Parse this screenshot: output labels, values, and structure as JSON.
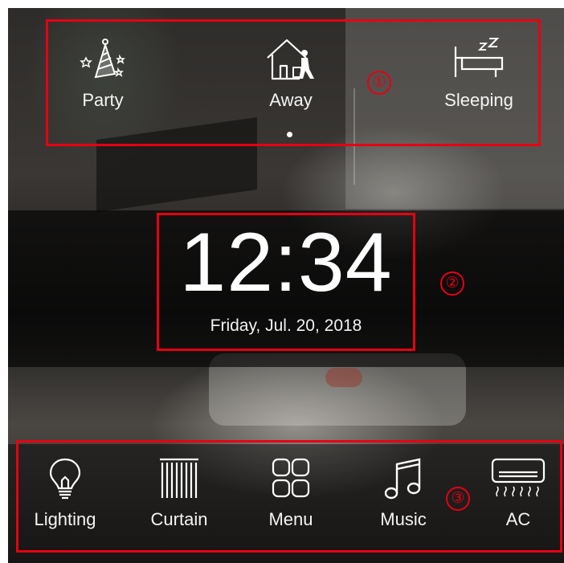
{
  "scenes": [
    {
      "label": "Party",
      "icon": "party-hat-icon"
    },
    {
      "label": "Away",
      "icon": "house-away-icon"
    },
    {
      "label": "Sleeping",
      "icon": "bed-sleep-icon"
    }
  ],
  "clock": {
    "time": "12:34",
    "date": "Friday, Jul. 20, 2018"
  },
  "nav": [
    {
      "label": "Lighting",
      "icon": "bulb-icon"
    },
    {
      "label": "Curtain",
      "icon": "curtain-icon"
    },
    {
      "label": "Menu",
      "icon": "grid-icon"
    },
    {
      "label": "Music",
      "icon": "music-note-icon"
    },
    {
      "label": "AC",
      "icon": "air-conditioner-icon"
    }
  ],
  "annotations": {
    "one": "①",
    "two": "②",
    "three": "③",
    "color": "#e60012"
  }
}
